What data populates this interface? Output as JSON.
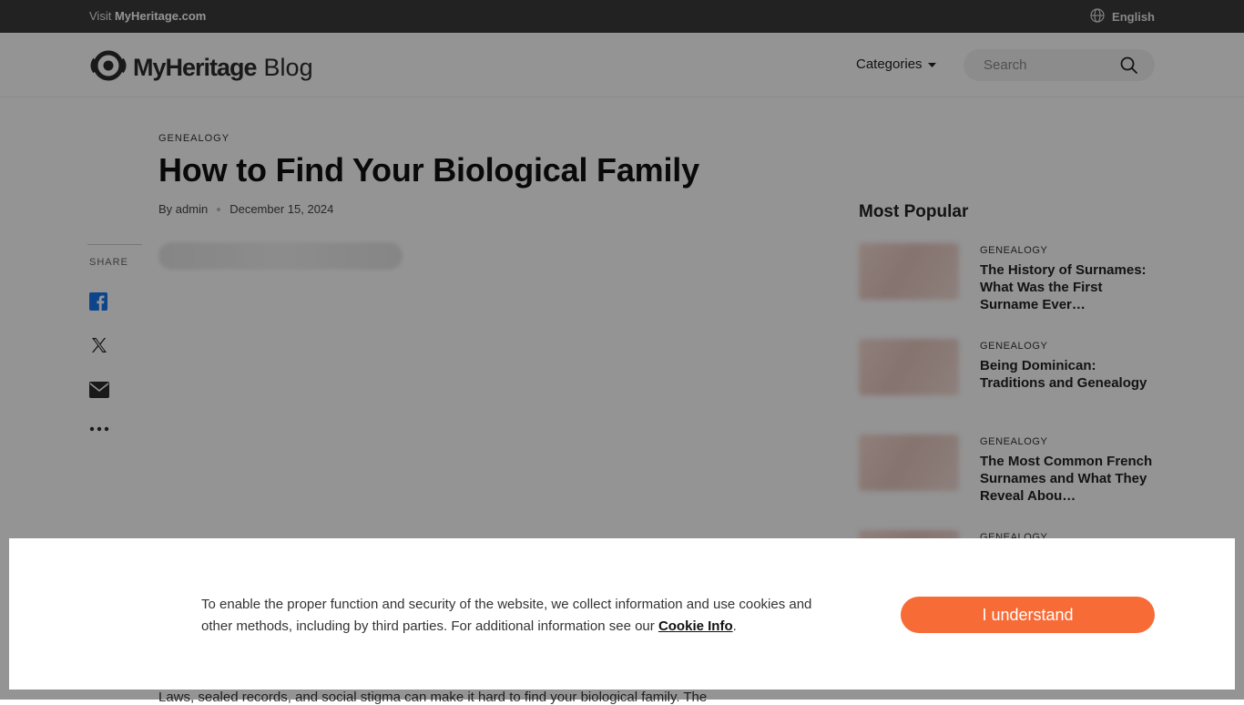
{
  "topbar": {
    "visit_prefix": "Visit ",
    "visit_brand": "MyHeritage.com",
    "language": "English"
  },
  "header": {
    "logo_brand": "MyHeritage",
    "logo_suffix": "Blog",
    "categories_label": "Categories",
    "search_placeholder": "Search"
  },
  "article": {
    "category": "GENEALOGY",
    "title": "How to Find Your Biological Family",
    "author": "By admin",
    "date": "December 15, 2024",
    "body_excerpt": "Laws, sealed records, and social stigma can make it hard to find your biological family. The"
  },
  "share": {
    "label": "SHARE",
    "buttons": [
      "facebook-icon",
      "x-icon",
      "email-icon",
      "more-icon"
    ]
  },
  "sidebar": {
    "title": "Most Popular",
    "items": [
      {
        "category": "GENEALOGY",
        "title": "The History of Surnames: What Was the First Surname Ever…"
      },
      {
        "category": "GENEALOGY",
        "title": "Being Dominican: Traditions and Genealogy"
      },
      {
        "category": "GENEALOGY",
        "title": "The Most Common French Surnames and What They Reveal Abou…"
      },
      {
        "category": "GENEALOGY",
        "title": ""
      }
    ]
  },
  "cookie": {
    "text": "To enable the proper function and security of the website, we collect information and use cookies and other methods, including by third parties. For additional information see our ",
    "link": "Cookie Info",
    "suffix": ".",
    "button": "I understand"
  },
  "colors": {
    "accent": "#f76b36",
    "topbar": "#3b3b3b",
    "facebook": "#1877f2"
  }
}
